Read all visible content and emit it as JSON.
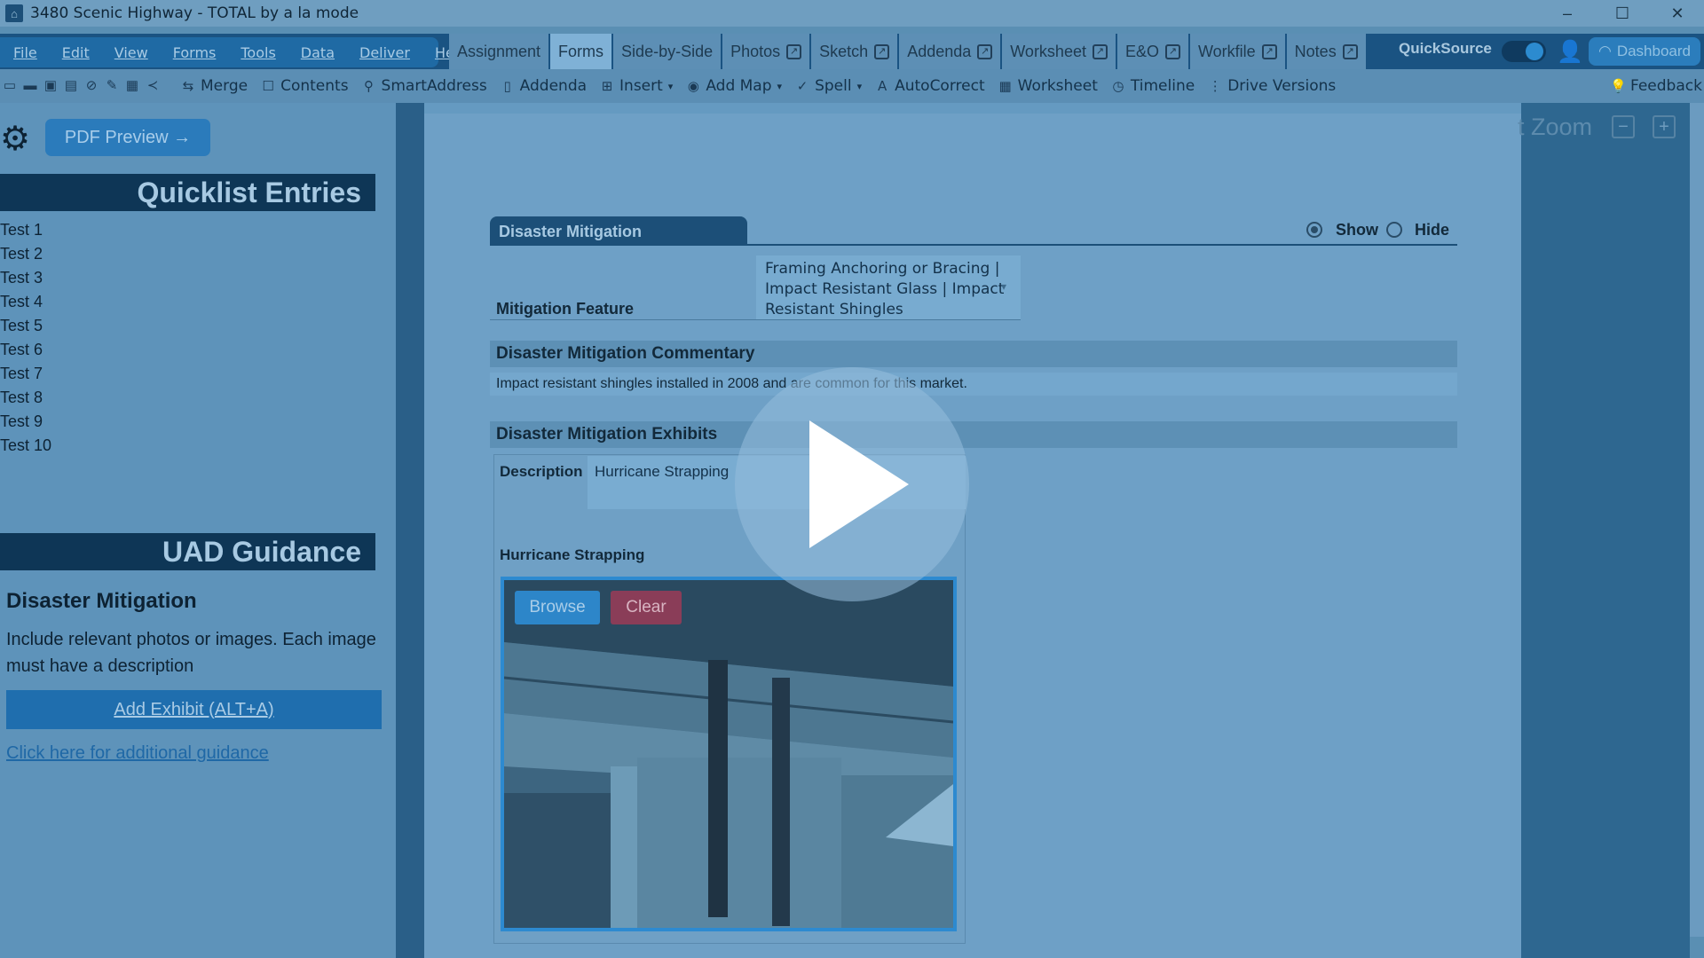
{
  "window": {
    "title": "3480 Scenic Highway - TOTAL by a la mode"
  },
  "menu": [
    "File",
    "Edit",
    "View",
    "Forms",
    "Tools",
    "Data",
    "Deliver",
    "Help"
  ],
  "tabs": [
    {
      "label": "Assignment",
      "popout": false
    },
    {
      "label": "Forms",
      "popout": false,
      "active": true
    },
    {
      "label": "Side-by-Side",
      "popout": false
    },
    {
      "label": "Photos",
      "popout": true
    },
    {
      "label": "Sketch",
      "popout": true
    },
    {
      "label": "Addenda",
      "popout": true
    },
    {
      "label": "Worksheet",
      "popout": true
    },
    {
      "label": "E&O",
      "popout": true
    },
    {
      "label": "Workfile",
      "popout": true
    },
    {
      "label": "Notes",
      "popout": true
    }
  ],
  "quicksource": "QuickSource",
  "dashboard": "Dashboard",
  "toolbar": {
    "merge": "Merge",
    "contents": "Contents",
    "smartaddress": "SmartAddress",
    "addenda": "Addenda",
    "insert": "Insert",
    "add_map": "Add Map",
    "spell": "Spell",
    "autocorrect": "AutoCorrect",
    "worksheet": "Worksheet",
    "timeline": "Timeline",
    "drive_versions": "Drive Versions",
    "feedback": "Feedback"
  },
  "sidebar": {
    "pdf_preview": "PDF Preview →",
    "quicklist_title": "Quicklist Entries",
    "quicklist": [
      "Test 1",
      "Test 2",
      "Test 3",
      "Test 4",
      "Test 5",
      "Test 6",
      "Test 7",
      "Test 8",
      "Test 9",
      "Test 10"
    ],
    "uad_title": "UAD Guidance",
    "guide_title": "Disaster Mitigation",
    "guide_text": "Include relevant photos or images. Each image must have a description",
    "add_exhibit": "Add Exhibit (ALT+A)",
    "guide_link": "Click here for additional guidance"
  },
  "zoom": {
    "label": "t Zoom",
    "minus": "−",
    "plus": "+"
  },
  "form": {
    "section_title": "Disaster Mitigation",
    "show": "Show",
    "hide": "Hide",
    "feature_label": "Mitigation Feature",
    "feature_value": "Framing Anchoring or Bracing | Impact Resistant Glass | Impact Resistant Shingles",
    "commentary_title": "Disaster Mitigation Commentary",
    "commentary_text": "Impact resistant shingles installed in 2008 and are common for this market.",
    "exhibits_title": "Disaster Mitigation Exhibits",
    "description_label": "Description",
    "description_value": "Hurricane Strapping",
    "exhibit_caption": "Hurricane Strapping",
    "browse": "Browse",
    "clear": "Clear"
  },
  "colors": {
    "accent": "#1f6eae",
    "header": "#0e3656",
    "overlay": "#5a8fb3"
  }
}
